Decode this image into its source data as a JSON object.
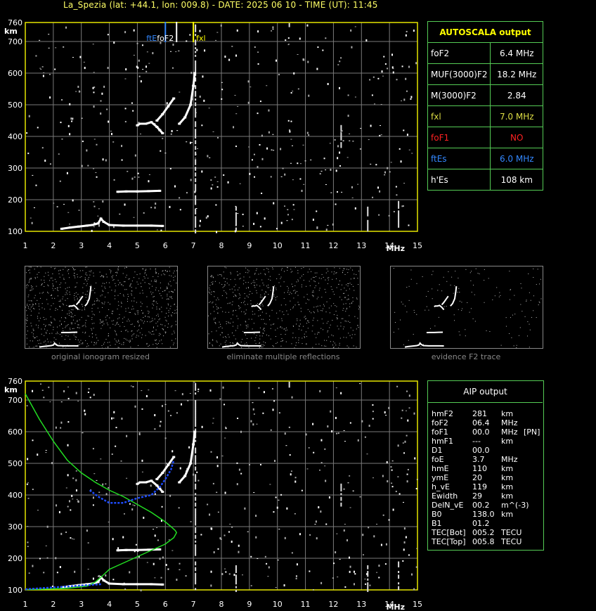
{
  "header": {
    "title": "La_Spezia (lat: +44.1, lon: 009.8) - DATE: 2025 06 10 - TIME (UT): 11:45"
  },
  "colors": {
    "axis": "#e6e600",
    "grid": "#7a7a7a",
    "green": "#55cc55",
    "blue": "#1e4cff",
    "profile": "#22dd22",
    "fof2": "#4488ff",
    "fxl": "#ffff00",
    "red": "#ff2222"
  },
  "autoscala": {
    "title": "AUTOSCALA output",
    "rows": [
      {
        "label": "foF2",
        "value": "6.4 MHz",
        "color": "#ffffff"
      },
      {
        "label": "MUF(3000)F2",
        "value": "18.2 MHz",
        "color": "#ffffff"
      },
      {
        "label": "M(3000)F2",
        "value": "2.84",
        "color": "#ffffff"
      },
      {
        "label": "fxl",
        "value": "7.0 MHz",
        "color": "#dddd44"
      },
      {
        "label": "foF1",
        "value": "NO",
        "color": "#ff2222"
      },
      {
        "label": "ftEs",
        "value": "6.0 MHz",
        "color": "#3388ff"
      },
      {
        "label": "h'Es",
        "value": "108    km",
        "color": "#ffffff"
      }
    ]
  },
  "aip": {
    "title": "AIP output",
    "rows": [
      {
        "name": "hmF2",
        "value": "281",
        "unit": "km",
        "extra": ""
      },
      {
        "name": "foF2",
        "value": "06.4",
        "unit": "MHz",
        "extra": ""
      },
      {
        "name": "foF1",
        "value": "00.0",
        "unit": "MHz",
        "extra": "[PN]"
      },
      {
        "name": "hmF1",
        "value": "---",
        "unit": "km",
        "extra": ""
      },
      {
        "name": "D1",
        "value": "00.0",
        "unit": "",
        "extra": ""
      },
      {
        "name": "foE",
        "value": "3.7",
        "unit": "MHz",
        "extra": ""
      },
      {
        "name": "hmE",
        "value": "110",
        "unit": "km",
        "extra": ""
      },
      {
        "name": "ymE",
        "value": "20",
        "unit": "km",
        "extra": ""
      },
      {
        "name": "h_vE",
        "value": "119",
        "unit": "km",
        "extra": ""
      },
      {
        "name": "Ewidth",
        "value": "29",
        "unit": "km",
        "extra": ""
      },
      {
        "name": "DelN_vE",
        "value": "00.2",
        "unit": "m^(-3)",
        "extra": ""
      },
      {
        "name": "B0",
        "value": "138.0",
        "unit": "km",
        "extra": ""
      },
      {
        "name": "B1",
        "value": "01.2",
        "unit": "",
        "extra": ""
      },
      {
        "name": "TEC[Bot]",
        "value": "005.2",
        "unit": "TECU",
        "extra": ""
      },
      {
        "name": "TEC[Top]",
        "value": "005.8",
        "unit": "TECU",
        "extra": ""
      }
    ]
  },
  "captions": [
    "original ionogram resized",
    "eliminate multiple reflections",
    "evidence F2 trace"
  ],
  "chart_data": [
    {
      "type": "scatter",
      "title": "",
      "xlabel": "MHz",
      "ylabel": "km",
      "xlim": [
        1,
        15
      ],
      "ylim": [
        100,
        760
      ],
      "xticks": [
        "1",
        "2",
        "3",
        "4",
        "5",
        "6",
        "7",
        "8",
        "9",
        "10",
        "11",
        "12",
        "13",
        "14",
        "15"
      ],
      "yticks": [
        "100",
        "200",
        "300",
        "400",
        "500",
        "600",
        "700",
        "760"
      ],
      "markers": [
        {
          "label": "ftE",
          "freq": 6.0,
          "color": "#3388ff"
        },
        {
          "label": "foF2",
          "freq": 6.4,
          "color": "#ffffff"
        },
        {
          "label": "fxl",
          "freq": 7.0,
          "color": "#ffff00"
        }
      ],
      "traces": {
        "e_layer": [
          [
            2.3,
            108
          ],
          [
            2.6,
            112
          ],
          [
            2.9,
            115
          ],
          [
            3.2,
            118
          ],
          [
            3.4,
            120
          ],
          [
            3.6,
            125
          ],
          [
            3.7,
            140
          ],
          [
            3.8,
            130
          ],
          [
            4.0,
            120
          ],
          [
            4.5,
            118
          ],
          [
            5.0,
            118
          ],
          [
            5.5,
            118
          ],
          [
            5.9,
            117
          ]
        ],
        "es_layer": [
          [
            4.3,
            225
          ],
          [
            4.6,
            226
          ],
          [
            5.0,
            226
          ],
          [
            5.4,
            227
          ],
          [
            5.8,
            228
          ]
        ],
        "f_trace_o": [
          [
            5.0,
            435
          ],
          [
            5.1,
            440
          ],
          [
            5.3,
            440
          ],
          [
            5.5,
            445
          ],
          [
            5.7,
            430
          ],
          [
            5.8,
            420
          ],
          [
            5.9,
            410
          ]
        ],
        "f_trace_o2": [
          [
            5.7,
            450
          ],
          [
            5.9,
            470
          ],
          [
            6.1,
            495
          ],
          [
            6.3,
            520
          ]
        ],
        "f_trace_x": [
          [
            6.5,
            440
          ],
          [
            6.7,
            460
          ],
          [
            6.9,
            500
          ],
          [
            7.0,
            560
          ],
          [
            7.05,
            600
          ]
        ]
      }
    },
    {
      "type": "line",
      "title": "",
      "xlabel": "MHz",
      "ylabel": "km",
      "xlim": [
        1,
        15
      ],
      "ylim": [
        100,
        760
      ],
      "series": [
        {
          "x": [
            1.0,
            1.5,
            2.0,
            2.5,
            3.0,
            3.5,
            4.0,
            4.5,
            5.0,
            5.5,
            6.0,
            6.2,
            6.35,
            6.4,
            6.3,
            6.0,
            5.5,
            5.0,
            4.5,
            4.0,
            3.7,
            3.5,
            3.2,
            2.5,
            1.5,
            1.0
          ],
          "y": [
            720,
            640,
            570,
            510,
            470,
            440,
            415,
            395,
            370,
            345,
            315,
            300,
            288,
            281,
            265,
            245,
            225,
            205,
            185,
            165,
            140,
            125,
            112,
            105,
            102,
            101
          ]
        },
        {
          "x": [
            3.3,
            3.6,
            4.0,
            4.5,
            5.0,
            5.5,
            5.8,
            6.0,
            6.2,
            6.3
          ],
          "y": [
            415,
            395,
            375,
            375,
            390,
            400,
            425,
            450,
            480,
            510
          ]
        }
      ]
    }
  ]
}
